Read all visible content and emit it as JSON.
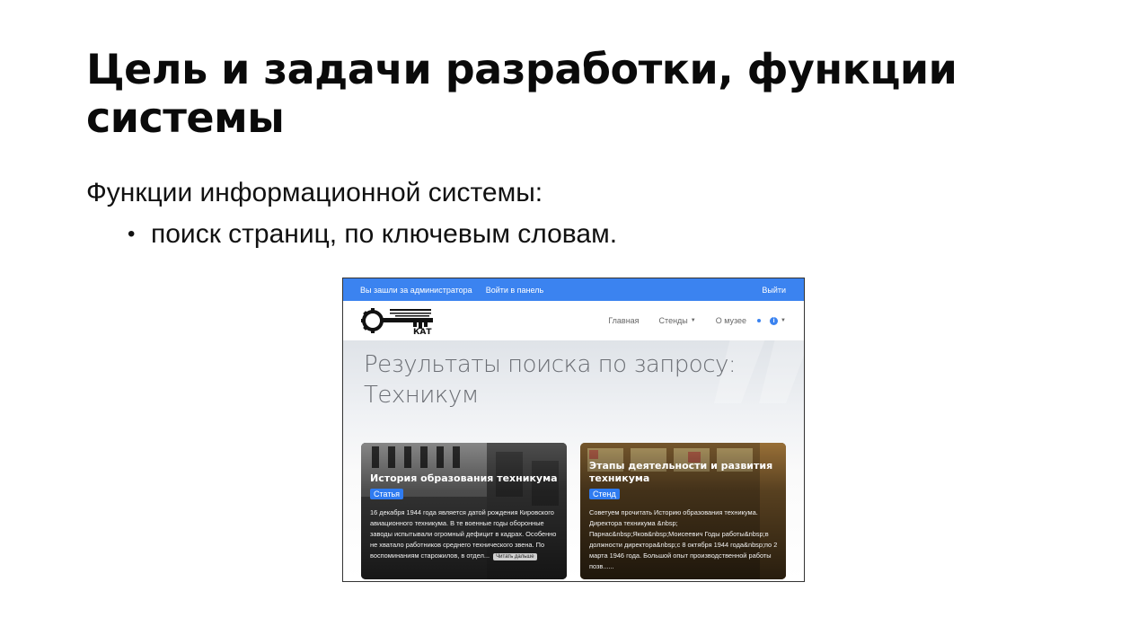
{
  "slide": {
    "title": "Цель и задачи разработки, функции системы",
    "subtitle": "Функции информационной системы:",
    "bullet": "поиск страниц, по ключевым словам."
  },
  "site": {
    "adminbar": {
      "logged_in_label": "Вы зашли за администратора",
      "panel_link": "Войти в панель",
      "logout": "Выйти"
    },
    "nav": {
      "home": "Главная",
      "stands": "Стенды",
      "about": "О музее"
    },
    "search_title": "Результаты поиска по запросу: Техникум",
    "cards": [
      {
        "title": "История образования техникума",
        "badge": "Статья",
        "text": "16 декабря 1944 года является датой рождения Кировского авиационного техникума. В те военные годы оборонные заводы испытывали огромный дефицит в кадрах. Особенно не хватало работников среднего технического звена. По воспоминаниям старожилов, в отдел...",
        "read_more": "Читать дальше"
      },
      {
        "title": "Этапы деятельности и развития техникума",
        "badge": "Стенд",
        "text": "Советуем прочитать Историю образования техникума. Директора техникума &nbsp; Парнас&nbsp;Яков&nbsp;Моисеевич Годы работы&nbsp;в должности директора&nbsp;с 8 октября 1944 года&nbsp;по 2 марта 1946 года. Большой опыт производственной работы позв......"
      }
    ],
    "logo_text": "КАТ",
    "colors": {
      "accent": "#3b83f0"
    }
  }
}
